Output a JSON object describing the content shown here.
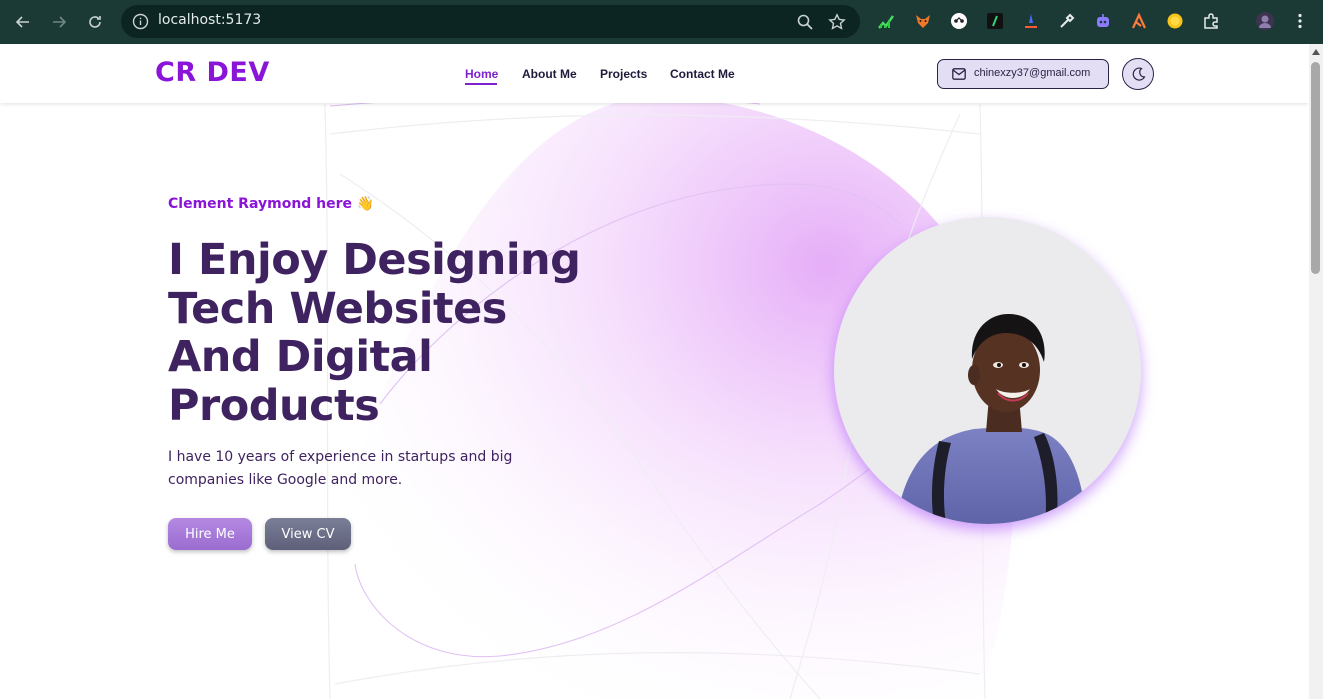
{
  "browser": {
    "url": "localhost:5173",
    "icons": [
      "back-icon",
      "forward-icon",
      "reload-icon",
      "site-info-icon",
      "zoom-icon",
      "bookmark-star-icon",
      "extensions-icon",
      "profile-avatar-icon",
      "menu-dots-icon"
    ]
  },
  "header": {
    "logo": "CR DEV",
    "nav": [
      {
        "label": "Home",
        "active": true
      },
      {
        "label": "About Me",
        "active": false
      },
      {
        "label": "Projects",
        "active": false
      },
      {
        "label": "Contact Me",
        "active": false
      }
    ],
    "email": "chinexzy37@gmail.com",
    "theme_icon": "moon-icon"
  },
  "hero": {
    "greeting": "Clement Raymond here 👋",
    "headline": "I Enjoy Designing Tech Websites And Digital Products",
    "description": "I have 10 years of experience in startups and big companies like Google and more.",
    "hire_label": "Hire Me",
    "cv_label": "View CV"
  },
  "colors": {
    "brand": "#8a14d8",
    "heading": "#3f2260",
    "browser_bar": "#1b3a36"
  }
}
